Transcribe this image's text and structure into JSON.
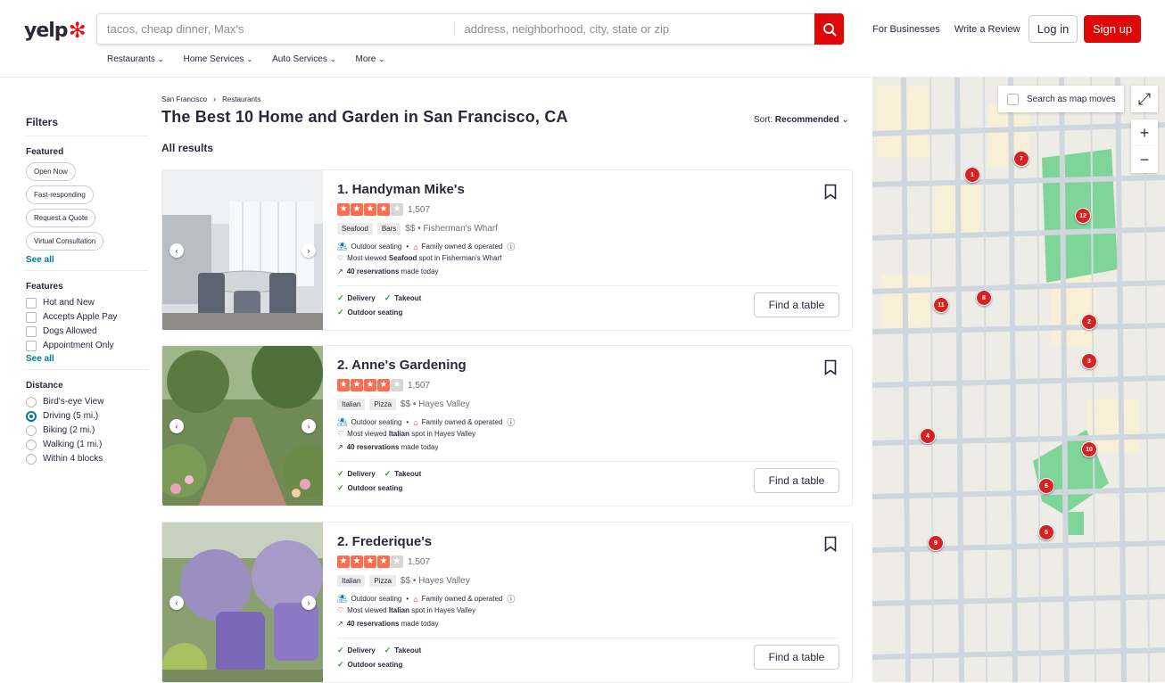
{
  "header": {
    "logo": "yelp",
    "search_find_placeholder": "tacos, cheap dinner, Max's",
    "search_near_placeholder": "address, neighborhood, city, state or zip",
    "for_businesses": "For Businesses",
    "write_review": "Write a Review",
    "login": "Log in",
    "signup": "Sign up",
    "accent": "#e00707"
  },
  "nav": [
    "Restaurants",
    "Home Services",
    "Auto Services",
    "More"
  ],
  "filters": {
    "title": "Filters",
    "featured_title": "Featured",
    "featured": [
      "Open Now",
      "Fast-responding",
      "Request a Quote",
      "Virtual Consultation"
    ],
    "see_all_1": "See all",
    "features_title": "Features",
    "features": [
      "Hot and New",
      "Accepts Apple Pay",
      "Dogs Allowed",
      "Appointment Only"
    ],
    "see_all_2": "See all",
    "distance_title": "Distance",
    "distance": [
      "Bird's-eye View",
      "Driving (5 mi.)",
      "Biking (2 mi.)",
      "Walking (1 mi.)",
      "Within 4 blocks"
    ],
    "distance_selected": "Driving (5 mi.)"
  },
  "breadcrumb": [
    "San Francisco",
    "Restaurants"
  ],
  "page_title": "The Best 10 Home and Garden in San Francisco, CA",
  "sort_label": "Sort:",
  "sort_value": "Recommended",
  "all_results": "All results",
  "results": [
    {
      "name": "1. Handyman Mike's",
      "rating": 4,
      "review_count": "1,507",
      "tags": [
        "Seafood",
        "Bars"
      ],
      "price_area": "$$ • Fisherman's Wharf",
      "amenity_1": "Outdoor seating",
      "amenity_2": "Family owned & operated",
      "most_viewed_pre": "Most viewed",
      "most_viewed_cat": "Seafood",
      "most_viewed_post": "spot in Fisherman's Wharf",
      "reservations": "40 reservations",
      "reservations_post": "made today",
      "opt_1": "Delivery",
      "opt_2": "Takeout",
      "opt_3": "Outdoor seating",
      "cta": "Find a table"
    },
    {
      "name": "2. Anne's Gardening",
      "rating": 4,
      "review_count": "1,507",
      "tags": [
        "Italian",
        "Pizza"
      ],
      "price_area": "$$ • Hayes Valley",
      "amenity_1": "Outdoor seating",
      "amenity_2": "Family owned & operated",
      "most_viewed_pre": "Most viewed",
      "most_viewed_cat": "Italian",
      "most_viewed_post": "spot in Hayes Valley",
      "reservations": "40 reservations",
      "reservations_post": "made today",
      "opt_1": "Delivery",
      "opt_2": "Takeout",
      "opt_3": "Outdoor seating",
      "cta": "Find a table"
    },
    {
      "name": "2. Frederique's",
      "rating": 4,
      "review_count": "1,507",
      "tags": [
        "Italian",
        "Pizza"
      ],
      "price_area": "$$ • Hayes Valley",
      "amenity_1": "Outdoor seating",
      "amenity_2": "Family owned & operated",
      "most_viewed_pre": "Most viewed",
      "most_viewed_cat": "Italian",
      "most_viewed_post": "spot in Hayes Valley",
      "reservations": "40 reservations",
      "reservations_post": "made today",
      "opt_1": "Delivery",
      "opt_2": "Takeout",
      "opt_3": "Outdoor seating",
      "cta": "Find a table"
    }
  ],
  "map": {
    "search_as_moves": "Search as map moves",
    "pins": [
      "1",
      "7",
      "12",
      "8",
      "11",
      "2",
      "3",
      "4",
      "10",
      "6",
      "5",
      "9"
    ]
  }
}
